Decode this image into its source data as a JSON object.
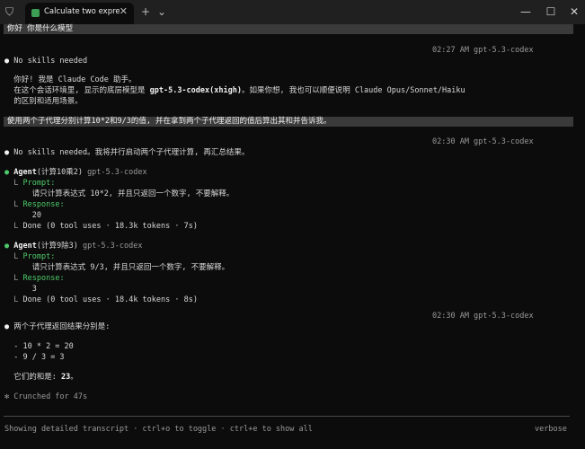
{
  "titlebar": {
    "tab_title": "Calculate two expressions",
    "tab_close": "✕",
    "new_tab": "+",
    "dropdown": "⌄",
    "minimize": "—",
    "maximize": "☐",
    "close": "✕"
  },
  "transcript": {
    "prompt1": "你好 你是什么模型",
    "meta1": "02:27 AM gpt-5.3-codex",
    "skills1": "No skills needed",
    "reply1_line1": "你好! 我是 Claude Code 助手。",
    "reply1_line2_a": "在这个会话环境里, 显示的底层模型是 ",
    "reply1_line2_b": "gpt-5.3-codex(xhigh)",
    "reply1_line2_c": "。如果你想, 我也可以顺便说明 Claude Opus/Sonnet/Haiku",
    "reply1_line3": "的区别和适用场景。",
    "prompt2": "使用两个子代理分别计算10*2和9/3的值, 并在拿到两个子代理返回的值后算出其和并告诉我。",
    "meta2": "02:30 AM gpt-5.3-codex",
    "skills2": "No skills needed。我将并行启动两个子代理计算, 再汇总结果。",
    "agent1": {
      "name": "Agent",
      "desc": "(计算10乘2)",
      "model": "gpt-5.3-codex",
      "prompt_label": "Prompt:",
      "prompt_text": "请只计算表达式 10*2, 并且只返回一个数字, 不要解释。",
      "response_label": "Response:",
      "response_text": "20",
      "done": "Done (0 tool uses · 18.3k tokens · 7s)"
    },
    "agent2": {
      "name": "Agent",
      "desc": "(计算9除3)",
      "model": "gpt-5.3-codex",
      "prompt_label": "Prompt:",
      "prompt_text": "请只计算表达式 9/3, 并且只返回一个数字, 不要解释。",
      "response_label": "Response:",
      "response_text": "3",
      "done": "Done (0 tool uses · 18.4k tokens · 8s)"
    },
    "meta3": "02:30 AM gpt-5.3-codex",
    "result_intro": "两个子代理返回结果分别是:",
    "result1": "- 10 * 2 = 20",
    "result2": "- 9 / 3 = 3",
    "sum_label": "它们的和是: ",
    "sum_value": "23",
    "sum_end": "。",
    "crunched": "Crunched for 47s"
  },
  "footer": {
    "hint": "Showing detailed transcript · ctrl+o to toggle · ctrl+e to show all",
    "mode": "verbose"
  },
  "glyphs": {
    "bullet": "●",
    "branch": "L",
    "caret": "❯",
    "spark": "✻"
  }
}
